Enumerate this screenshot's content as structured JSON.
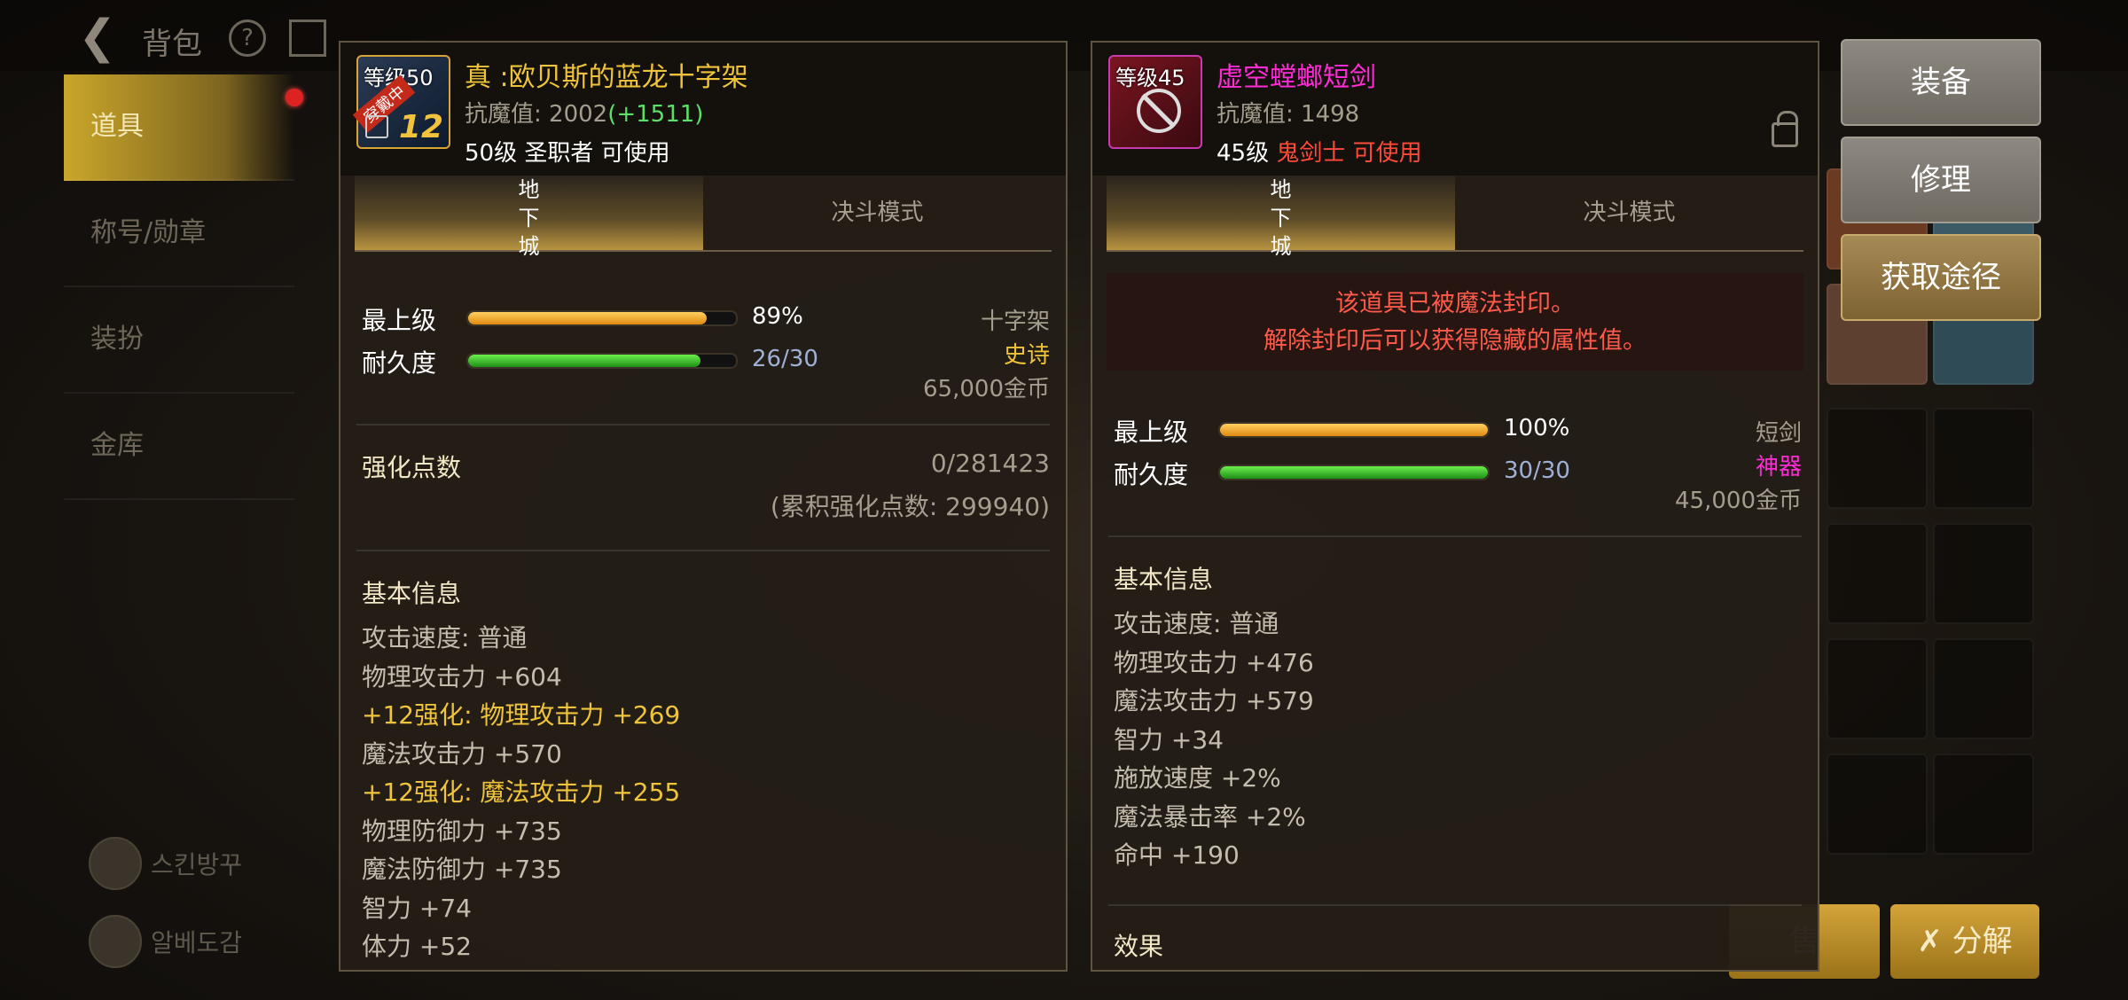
{
  "colors": {
    "gold_text": "#f0c43a",
    "magenta_text": "#ff2bd6",
    "red_text": "#ff4a3a",
    "green_text": "#5de06a",
    "progress_orange": "#f0a020",
    "progress_green": "#3bbb2b",
    "numeric_blue": "#9fb0d6"
  },
  "topbar": {
    "title": "背包"
  },
  "sidebar": {
    "items": [
      {
        "label": "道具"
      },
      {
        "label": "称号/勋章"
      },
      {
        "label": "装扮"
      },
      {
        "label": "金库"
      }
    ],
    "bottom_items": [
      {
        "label": "스킨방꾸"
      },
      {
        "label": "알베도감"
      }
    ]
  },
  "actions": {
    "equip": "装备",
    "repair": "修理",
    "obtain": "获取途径"
  },
  "bottom_buttons": {
    "sell": "售",
    "disassemble": "分解"
  },
  "left_item": {
    "icon_level": "等级50",
    "icon_badge": "穿戴中",
    "icon_enhance": "12",
    "name": "真 :欧贝斯的蓝龙十字架",
    "resist_label": "抗魔值:",
    "resist_value": "2002",
    "resist_bonus": "(+1511)",
    "req_level": "50级",
    "req_class": "圣职者",
    "req_usable": "可使用",
    "tab_dungeon": "地\n下\n城",
    "tab_duel": "决斗模式",
    "grade_label": "最上级",
    "grade_value": "89%",
    "grade_fraction": 0.89,
    "durability_label": "耐久度",
    "durability_value": "26/30",
    "durability_fraction": 0.8667,
    "type": "十字架",
    "rarity": "史诗",
    "price": "65,000金币",
    "enhance_label": "强化点数",
    "enhance_value": "0/281423",
    "enhance_total": "(累积强化点数: 299940)",
    "basic_info": "基本信息",
    "attributes": [
      {
        "text": "攻击速度:  普通",
        "highlight": false
      },
      {
        "text": "物理攻击力 +604",
        "highlight": false
      },
      {
        "text": "+12强化:  物理攻击力 +269",
        "highlight": true
      },
      {
        "text": "魔法攻击力 +570",
        "highlight": false
      },
      {
        "text": "+12强化:  魔法攻击力 +255",
        "highlight": true
      },
      {
        "text": "物理防御力 +735",
        "highlight": false
      },
      {
        "text": "魔法防御力 +735",
        "highlight": false
      },
      {
        "text": "智力 +74",
        "highlight": false
      },
      {
        "text": "体力 +52",
        "highlight": false
      }
    ]
  },
  "right_item": {
    "icon_level": "等级45",
    "name": "虚空螳螂短剑",
    "resist_label": "抗魔值:",
    "resist_value": "1498",
    "req_level": "45级",
    "req_class": "鬼剑士",
    "req_usable": "可使用",
    "tab_dungeon": "地\n下\n城",
    "tab_duel": "决斗模式",
    "seal_line1": "该道具已被魔法封印。",
    "seal_line2": "解除封印后可以获得隐藏的属性值。",
    "grade_label": "最上级",
    "grade_value": "100%",
    "grade_fraction": 1.0,
    "durability_label": "耐久度",
    "durability_value": "30/30",
    "durability_fraction": 1.0,
    "type": "短剑",
    "rarity": "神器",
    "price": "45,000金币",
    "basic_info": "基本信息",
    "attributes": [
      {
        "text": "攻击速度:  普通"
      },
      {
        "text": "物理攻击力 +476"
      },
      {
        "text": "魔法攻击力 +579"
      },
      {
        "text": "智力 +34"
      },
      {
        "text": "施放速度 +2%"
      },
      {
        "text": "魔法暴击率 +2%"
      },
      {
        "text": "命中 +190"
      }
    ],
    "effect_label": "效果"
  }
}
